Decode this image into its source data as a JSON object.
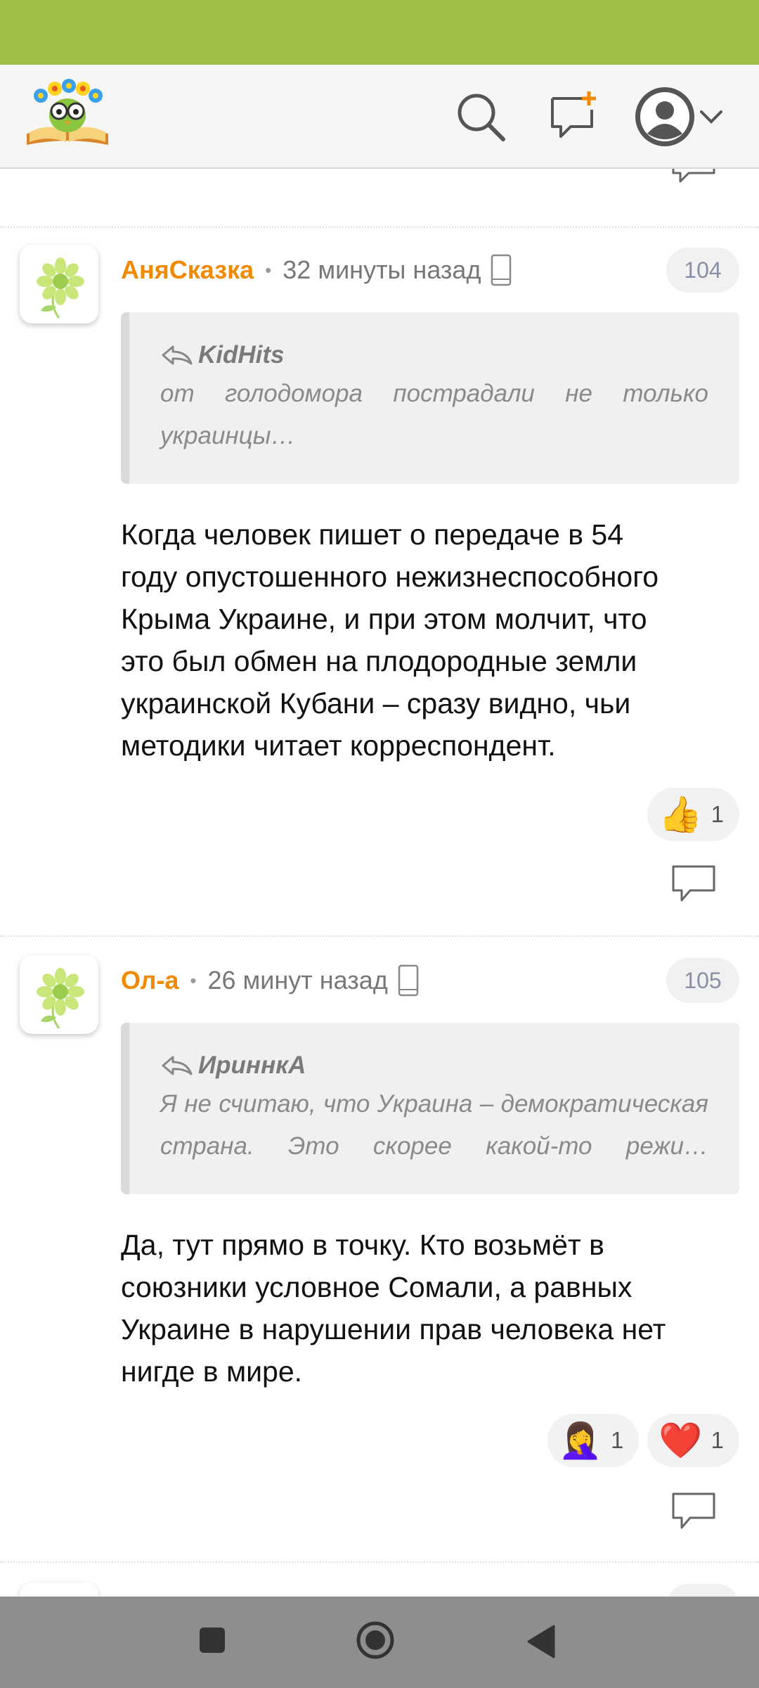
{
  "colors": {
    "statusbar": "#9dc044",
    "author": "#f08a00",
    "badge_text": "#8a8fa6",
    "navbar": "#8e8e8e"
  },
  "header": {
    "logo": "reading-owl-logo",
    "icons": [
      "search-icon",
      "new-post-icon",
      "account-avatar-icon",
      "chevron-down-icon"
    ]
  },
  "comments": [
    {
      "author": "АняСказка",
      "time": "32 минуты назад",
      "device_icon": "mobile-phone-icon",
      "number": "104",
      "quote": {
        "author": "KidHits",
        "text": "от голодомора пострадали не только украинцы…"
      },
      "lines": [
        "Когда человек пишет о передаче в 54",
        "году опустошенного нежизнеспособного",
        "Крыма Украине, и при этом молчит, что",
        "это был обмен на плодородные земли",
        "украинской Кубани – сразу видно, чьи",
        "методики читает корреспондент."
      ],
      "reactions": [
        {
          "emoji": "👍",
          "icon": "thumbs-up-icon",
          "count": "1"
        }
      ]
    },
    {
      "author": "Ол-а",
      "time": "26 минут назад",
      "device_icon": "mobile-phone-icon",
      "number": "105",
      "quote": {
        "author": "ИриннкА",
        "text": "Я не считаю, что Украина – демократическая страна. Это скорее какой-то режи…"
      },
      "lines": [
        "Да, тут прямо в точку. Кто возьмёт в",
        "союзники условное Сомали, а равных",
        "Украине в нарушении прав человека нет",
        "нигде в мире."
      ],
      "reactions": [
        {
          "emoji": "🤦‍♀️",
          "icon": "facepalm-icon",
          "count": "1"
        },
        {
          "emoji": "❤️",
          "icon": "heart-icon",
          "count": "1"
        }
      ]
    }
  ],
  "navbar": {
    "icons": [
      "recents-square-icon",
      "home-circle-icon",
      "back-triangle-icon"
    ]
  }
}
